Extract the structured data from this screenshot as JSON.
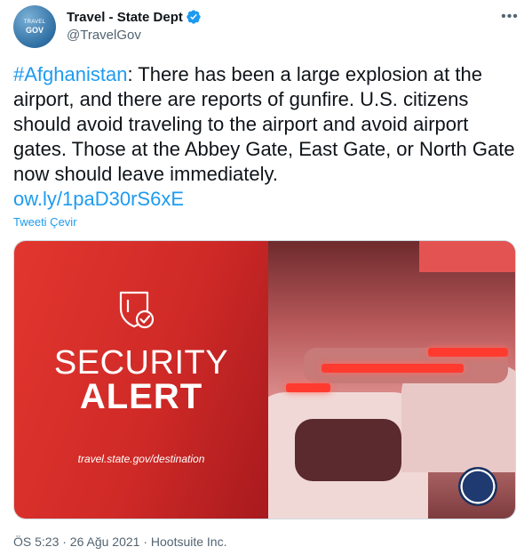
{
  "account": {
    "avatar_line1": "TRAVEL",
    "avatar_line2": "GOV",
    "name": "Travel - State Dept",
    "handle": "@TravelGov",
    "verified_icon": "verified-badge-icon",
    "more_icon": "more-icon"
  },
  "tweet": {
    "hashtag": "#Afghanistan",
    "body": ": There has been a large explosion at the airport, and there are reports of gunfire. U.S. citizens should avoid traveling to the airport and avoid airport gates. Those at the Abbey Gate, East Gate, or North Gate now should leave immediately.",
    "link": "ow.ly/1paD30rS6xE",
    "translate_label": "Tweeti Çevir"
  },
  "media": {
    "line1": "SECURITY",
    "line2": "ALERT",
    "url_text": "travel.state.gov/destination",
    "shield_icon": "shield-check-icon",
    "seal_icon": "state-department-seal-icon"
  },
  "meta": {
    "text": "ÖS 5:23 · 26 Ağu 2021 · Hootsuite Inc."
  },
  "colors": {
    "accent": "#1d9bf0",
    "alert_red": "#d62f2b",
    "secondary_text": "#536471"
  }
}
